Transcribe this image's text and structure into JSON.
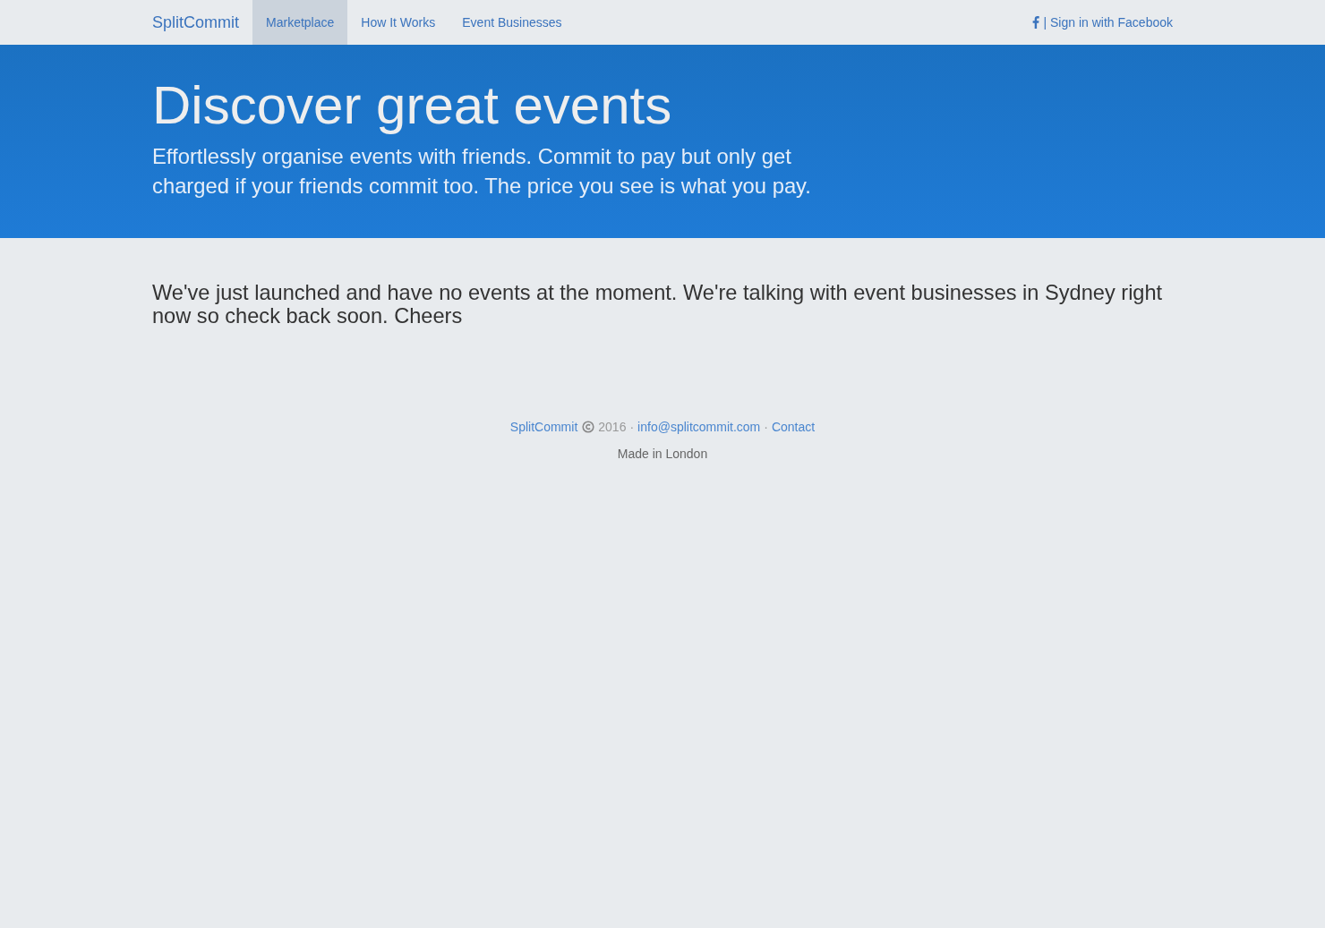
{
  "navbar": {
    "brand": "SplitCommit",
    "items": [
      {
        "label": "Marketplace",
        "selected": true
      },
      {
        "label": "How It Works",
        "selected": false
      },
      {
        "label": "Event Businesses",
        "selected": false
      }
    ],
    "sign_in": "| Sign in with Facebook"
  },
  "hero": {
    "title": "Discover great events",
    "lead": "Effortlessly organise events with friends. Commit to pay but only get charged if your friends commit too. The price you see is what you pay."
  },
  "message": "We've just launched and have no events at the moment. We're talking with event businesses in Sydney right now so check back soon. Cheers",
  "footer": {
    "brand": "SplitCommit",
    "year": "2016",
    "separator_1": "·",
    "email": "info@splitcommit.com",
    "separator_2": "·",
    "contact": "Contact",
    "note": "Made in London"
  }
}
